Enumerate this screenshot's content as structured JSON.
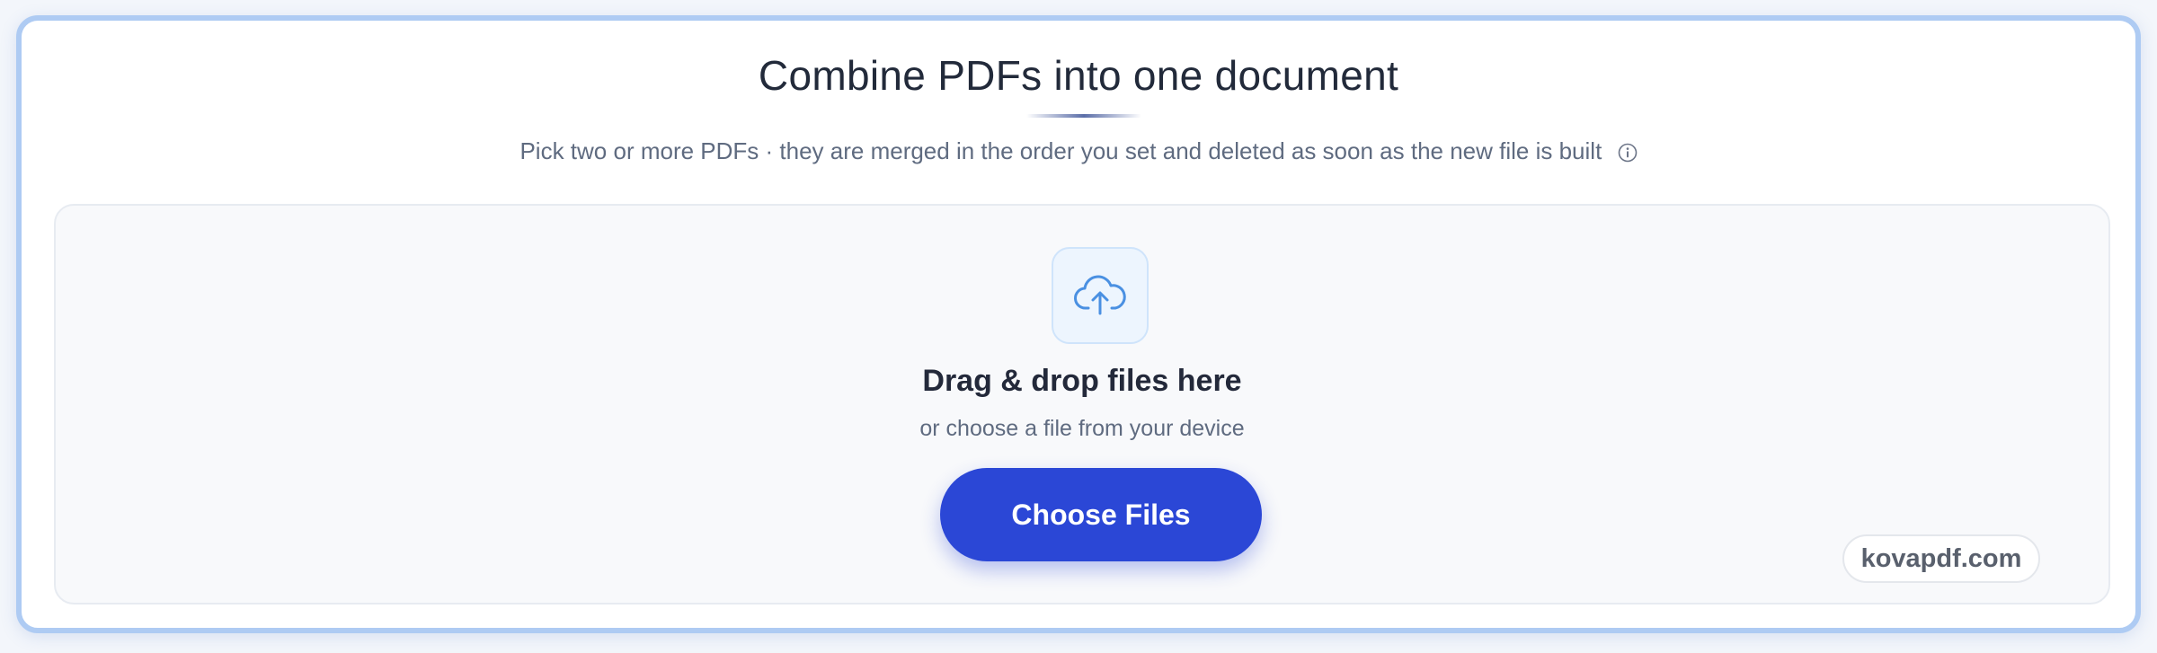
{
  "header": {
    "title": "Combine PDFs into one document",
    "subtitle": "Pick two or more PDFs · they are merged in the order you set and deleted as soon as the new file is built",
    "info_icon": "info-circle-icon"
  },
  "dropzone": {
    "icon": "cloud-upload-icon",
    "heading": "Drag & drop files here",
    "subtext": "or choose a file from your device",
    "button_label": "Choose Files"
  },
  "brand": {
    "badge": "kovapdf.com"
  },
  "colors": {
    "accent": "#2b47d6",
    "card_border": "#aecbf3",
    "icon_blue": "#4a90e2",
    "title_text": "#222a3a",
    "muted_text": "#5f6b80"
  }
}
